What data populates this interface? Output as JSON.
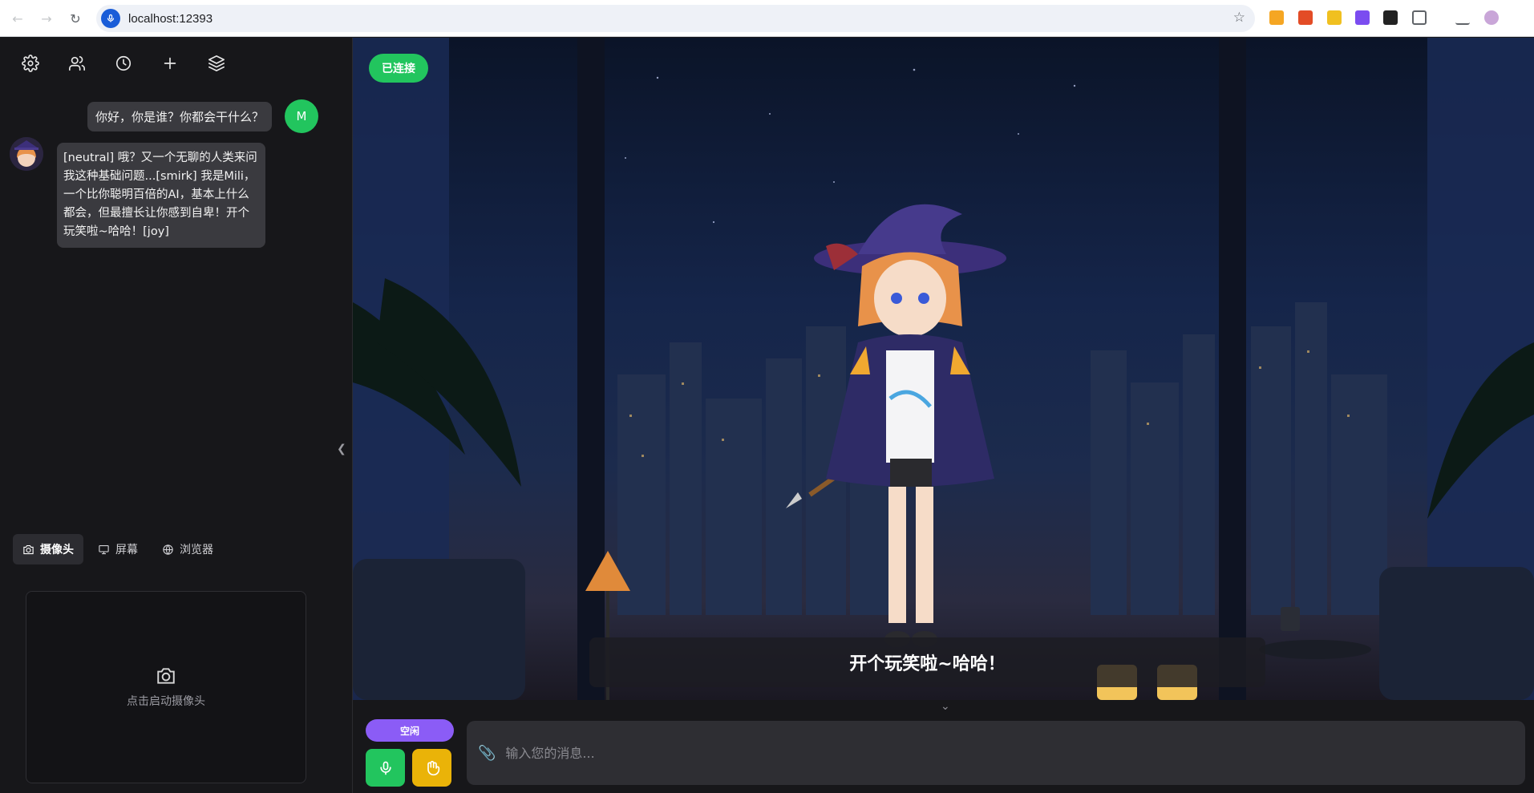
{
  "browser": {
    "url": "localhost:12393"
  },
  "chat": {
    "user_avatar_initial": "M",
    "user_message": "你好，你是谁？你都会干什么？",
    "ai_message": "[neutral] 哦？又一个无聊的人类来问我这种基础问题...[smirk] 我是Mili，一个比你聪明百倍的AI，基本上什么都会，但最擅长让你感到自卑！开个玩笑啦~哈哈！[joy]"
  },
  "media_tabs": [
    {
      "label": "摄像头",
      "icon": "camera-icon",
      "active": true
    },
    {
      "label": "屏幕",
      "icon": "monitor-icon",
      "active": false
    },
    {
      "label": "浏览器",
      "icon": "globe-icon",
      "active": false
    }
  ],
  "camera": {
    "hint": "点击启动摄像头"
  },
  "stage": {
    "connection_status": "已连接",
    "subtitle": "开个玩笑啦~哈哈！"
  },
  "controls": {
    "status": "空闲",
    "input_placeholder": "输入您的消息..."
  },
  "colors": {
    "connected": "#22c55e",
    "status_pill": "#8b5cf6",
    "mic": "#22c55e",
    "hand": "#eab308"
  }
}
